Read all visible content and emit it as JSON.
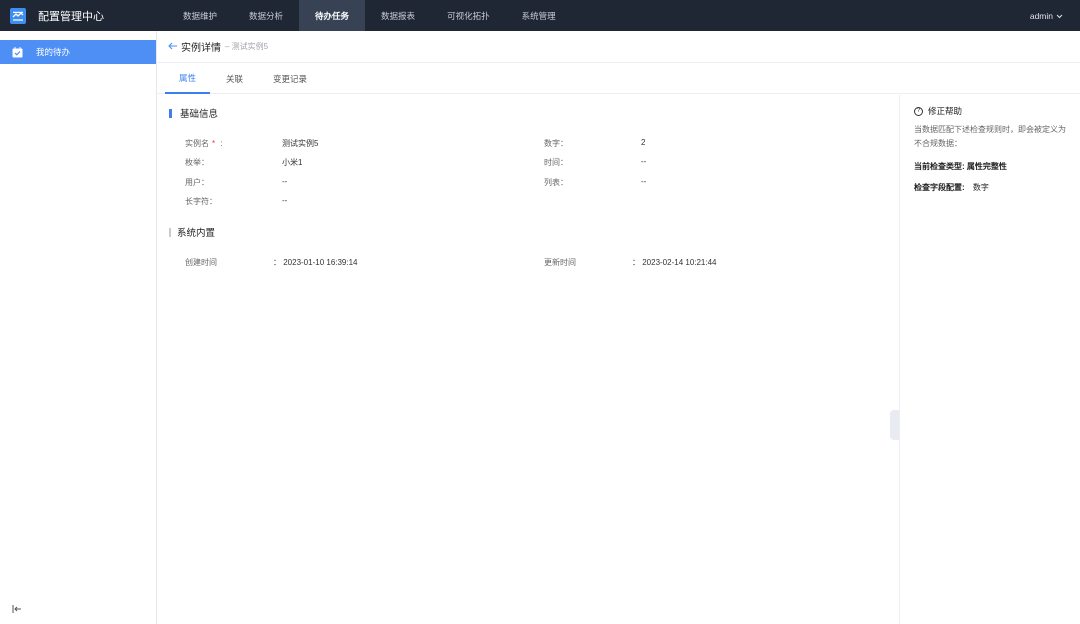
{
  "app": {
    "title": "配置管理中心"
  },
  "nav": {
    "items": [
      {
        "label": "数据维护"
      },
      {
        "label": "数据分析"
      },
      {
        "label": "待办任务"
      },
      {
        "label": "数据报表"
      },
      {
        "label": "可视化拓扑"
      },
      {
        "label": "系统管理"
      }
    ],
    "active": "待办任务"
  },
  "user": {
    "name": "admin"
  },
  "sidebar": {
    "items": [
      {
        "label": "我的待办"
      }
    ]
  },
  "page": {
    "title": "实例详情",
    "subtitle": "– 测试实例5"
  },
  "tabs": [
    {
      "label": "属性"
    },
    {
      "label": "关联"
    },
    {
      "label": "变更记录"
    }
  ],
  "basic": {
    "title": "基础信息",
    "fields": {
      "instance_name": {
        "label": "实例名",
        "required": "*",
        "colon": ":",
        "value": "测试实例5"
      },
      "enum": {
        "label": "枚举：",
        "value": "小米1"
      },
      "user": {
        "label": "用户：",
        "value": "--"
      },
      "longchar": {
        "label": "长字符：",
        "value": "--"
      },
      "number": {
        "label": "数字：",
        "value": "2"
      },
      "time": {
        "label": "时间：",
        "value": "--"
      },
      "list": {
        "label": "列表：",
        "value": "--"
      }
    }
  },
  "system": {
    "title": "系统内置",
    "created": {
      "label": "创建时间",
      "value": "： 2023-01-10 16:39:14"
    },
    "updated": {
      "label": "更新时间",
      "value": "： 2023-02-14 10:21:44"
    }
  },
  "help": {
    "title": "修正帮助",
    "desc": "当数据匹配下述检查规则时，即会被定义为不合规数据：",
    "check_type_label": "当前检查类型:",
    "check_type_value": "属性完整性",
    "check_field_label": "检查字段配置:",
    "check_field_value": "数字"
  },
  "colors": {
    "topbar": "#1f2634",
    "accent": "#4d8ff5",
    "tab_active": "#3d7ff0"
  }
}
